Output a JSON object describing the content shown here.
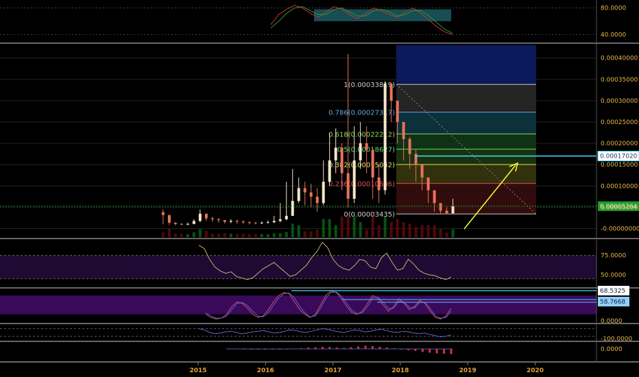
{
  "colors": {
    "background": "#000000",
    "axis_text": "#e8b84a",
    "candle_up": "#f5e6c8",
    "candle_down": "#e8735a",
    "volume_green": "#0a5a12",
    "volume_red": "#5a0a0a",
    "rsi_band": "#1e0a33",
    "stoch_band": "#3a0a5a",
    "fib_zone_top": "#0b1a5a",
    "arrow": "#ffff33",
    "current_price_tag": "#1e9e2e",
    "resistance_line": "#40e0ff"
  },
  "chart_data": [
    {
      "type": "line",
      "name": "top-oscillator",
      "y_ticks": [
        "80.0000",
        "40.0000"
      ],
      "ylim": [
        30,
        90
      ],
      "x": [
        "2016-09",
        "2016-10",
        "2016-11",
        "2016-12",
        "2017-01",
        "2017-02",
        "2017-03",
        "2017-04",
        "2017-05",
        "2017-06",
        "2017-07",
        "2017-08",
        "2017-09",
        "2017-10",
        "2017-11",
        "2017-12",
        "2018-01",
        "2018-02",
        "2018-03",
        "2018-04",
        "2018-05",
        "2018-06",
        "2018-07",
        "2018-08"
      ],
      "series": [
        {
          "color": "#d03030",
          "values": [
            55,
            70,
            78,
            84,
            80,
            72,
            66,
            74,
            82,
            78,
            70,
            64,
            72,
            80,
            76,
            70,
            66,
            74,
            80,
            72,
            62,
            52,
            44,
            40
          ]
        },
        {
          "color": "#2a9a3a",
          "values": [
            50,
            60,
            72,
            80,
            82,
            76,
            70,
            70,
            78,
            80,
            74,
            68,
            68,
            76,
            78,
            74,
            68,
            70,
            76,
            76,
            68,
            58,
            48,
            42
          ]
        }
      ]
    },
    {
      "type": "candlestick",
      "name": "price",
      "y_ticks": [
        "0.00040000",
        "0.00035000",
        "0.00030000",
        "0.00025000",
        "0.00020000",
        "0.00015000",
        "0.00010000",
        "0.00005000",
        "-0.00000000"
      ],
      "ylim": [
        -2e-05,
        0.00043
      ],
      "x_ticks": [
        "2015",
        "2016",
        "2017",
        "2018",
        "2019",
        "2020"
      ],
      "close_series": [
        3.2e-05,
        1.4e-05,
        1.1e-05,
        1e-05,
        1.1e-05,
        1.8e-05,
        3.5e-05,
        2.4e-05,
        2.2e-05,
        2e-05,
        1.6e-05,
        1.8e-05,
        1.7e-05,
        1.5e-05,
        1.4e-05,
        1.3e-05,
        1.4e-05,
        1.5e-05,
        1.8e-05,
        2.2e-05,
        3e-05,
        6.5e-05,
        9.5e-05,
        8.5e-05,
        7.5e-05,
        6e-05,
        0.00011,
        0.00016,
        0.00019,
        0.00013,
        7e-05,
        0.00016,
        0.0002,
        0.000185,
        0.00012,
        9e-05,
        0.00034,
        0.0003,
        0.00025,
        0.00021,
        0.000175,
        0.00015,
        0.00012,
        9e-05,
        6e-05,
        4.2e-05,
        3.6e-05,
        5.3e-05
      ],
      "high_series": [
        4.5e-05,
        2e-05,
        1.5e-05,
        1.3e-05,
        1.4e-05,
        2.2e-05,
        4.5e-05,
        3.5e-05,
        2.8e-05,
        2.5e-05,
        2e-05,
        2.2e-05,
        2.1e-05,
        1.9e-05,
        1.7e-05,
        1.6e-05,
        1.7e-05,
        1.9e-05,
        3e-05,
        6e-05,
        0.00011,
        0.00014,
        0.00012,
        0.00011,
        0.000105,
        9.5e-05,
        0.00016,
        0.000225,
        0.000235,
        0.0002,
        0.00041,
        0.00024,
        0.00025,
        0.00024,
        0.00017,
        0.00015,
        0.000345,
        0.00033,
        0.00029,
        0.00025,
        0.000215,
        0.000185,
        0.00015,
        0.000115,
        8e-05,
        6e-05,
        5e-05,
        7e-05
      ],
      "low_series": [
        1e-05,
        9e-06,
        8e-06,
        8e-06,
        8e-06,
        1e-05,
        1.5e-05,
        1.8e-05,
        1.6e-05,
        1.4e-05,
        1.2e-05,
        1.3e-05,
        1.2e-05,
        1.1e-05,
        1e-05,
        1e-05,
        1.1e-05,
        1.2e-05,
        1.3e-05,
        1.5e-05,
        2e-05,
        3e-05,
        6e-05,
        5.5e-05,
        5e-05,
        4e-05,
        5.5e-05,
        0.0001,
        0.00013,
        9e-05,
        5e-05,
        6e-05,
        0.00014,
        0.00013,
        7e-05,
        6e-05,
        8e-05,
        0.00025,
        0.0002,
        0.00016,
        0.00014,
        0.00011,
        9e-05,
        6e-05,
        4e-05,
        3.4e-05,
        3.4e-05,
        3.5e-05
      ],
      "current_price": "0.00005264",
      "resistance_price": "0.00017020",
      "fibonacci": {
        "low": 3.435e-05,
        "high": 0.00033819,
        "levels": [
          {
            "ratio": 1,
            "price": 0.00033819,
            "label": "1(0.00033819)",
            "color": "#cccccc"
          },
          {
            "ratio": 0.786,
            "price": 0.00027317,
            "label": "0.786(0.00027317)",
            "color": "#5aa9e6"
          },
          {
            "ratio": 0.618,
            "price": 0.00022212,
            "label": "0.618(0.00022212)",
            "color": "#8be05a"
          },
          {
            "ratio": 0.5,
            "price": 0.00018627,
            "label": "0.5(0.00018627)",
            "color": "#5ae06a"
          },
          {
            "ratio": 0.382,
            "price": 0.00015042,
            "label": "0.382(0.00015042)",
            "color": "#d8e05a"
          },
          {
            "ratio": 0.236,
            "price": 0.00010606,
            "label": "0.236(0.00010606)",
            "color": "#e04a4a"
          },
          {
            "ratio": 0,
            "price": 3.435e-05,
            "label": "0(0.00003435)",
            "color": "#cccccc"
          }
        ]
      }
    },
    {
      "type": "line",
      "name": "rsi",
      "y_ticks": [
        "75.0000",
        "50.0000"
      ],
      "ylim": [
        35,
        95
      ],
      "series": [
        {
          "color": "#c8b070",
          "values": [
            88,
            84,
            70,
            60,
            55,
            52,
            54,
            48,
            46,
            44,
            46,
            52,
            58,
            62,
            66,
            60,
            54,
            48,
            50,
            56,
            62,
            72,
            80,
            92,
            85,
            70,
            62,
            58,
            56,
            62,
            70,
            68,
            60,
            58,
            72,
            78,
            66,
            56,
            58,
            70,
            64,
            56,
            52,
            50,
            49,
            46,
            44,
            47
          ]
        }
      ]
    },
    {
      "type": "line",
      "name": "stochastic",
      "y_ticks": [
        "68.5325",
        "58.7668",
        "0.0000"
      ],
      "ylim": [
        -5,
        100
      ],
      "series": [
        {
          "color": "#e04a4a",
          "values": [
            20,
            10,
            5,
            8,
            20,
            45,
            60,
            55,
            40,
            20,
            10,
            15,
            35,
            60,
            80,
            90,
            85,
            60,
            35,
            20,
            10,
            20,
            50,
            80,
            95,
            90,
            70,
            45,
            25,
            20,
            30,
            55,
            80,
            70,
            50,
            30,
            45,
            70,
            55,
            35,
            45,
            65,
            55,
            30,
            10,
            5,
            15,
            40
          ]
        },
        {
          "color": "#4a6ae0",
          "values": [
            25,
            15,
            8,
            8,
            15,
            35,
            55,
            58,
            48,
            30,
            15,
            12,
            25,
            50,
            72,
            86,
            88,
            72,
            45,
            25,
            12,
            15,
            40,
            70,
            90,
            92,
            78,
            55,
            32,
            22,
            25,
            45,
            72,
            75,
            58,
            38,
            40,
            62,
            60,
            42,
            40,
            58,
            58,
            38,
            15,
            8,
            10,
            30
          ]
        }
      ]
    },
    {
      "type": "line",
      "name": "williams-r",
      "y_ticks": [
        "-100.0000"
      ],
      "ylim": [
        -110,
        10
      ],
      "series": [
        {
          "color": "#5a6ad0",
          "values": [
            -20,
            -30,
            -50,
            -60,
            -55,
            -45,
            -40,
            -50,
            -60,
            -55,
            -45,
            -40,
            -35,
            -45,
            -55,
            -50,
            -40,
            -30,
            -35,
            -45,
            -50,
            -40,
            -30,
            -20,
            -25,
            -35,
            -45,
            -50,
            -40,
            -30,
            -35,
            -45,
            -40,
            -30,
            -25,
            -35,
            -45,
            -50,
            -40,
            -45,
            -55,
            -60,
            -55,
            -65,
            -75,
            -85,
            -80,
            -70
          ]
        }
      ]
    },
    {
      "type": "bar",
      "name": "macd-histogram",
      "y_ticks": [
        "0.0000"
      ],
      "ylim": [
        -1,
        1
      ],
      "values": [
        0.05,
        0.04,
        0.02,
        0.0,
        -0.02,
        -0.03,
        -0.02,
        0.0,
        0.02,
        0.05,
        0.1,
        0.2,
        0.25,
        0.3,
        0.28,
        0.2,
        0.15,
        0.25,
        0.35,
        0.45,
        0.4,
        0.3,
        0.2,
        0.1,
        -0.05,
        -0.2,
        -0.3,
        -0.45,
        -0.55,
        -0.65,
        -0.7,
        -0.75
      ]
    }
  ]
}
